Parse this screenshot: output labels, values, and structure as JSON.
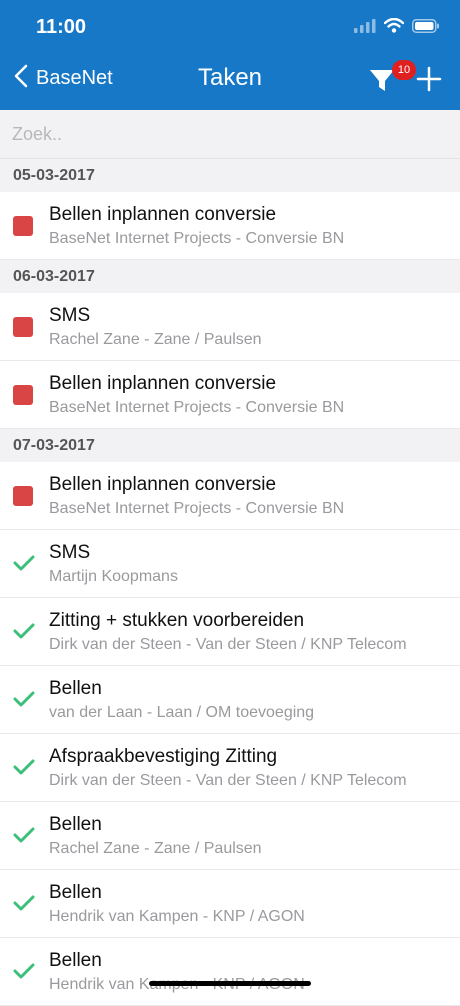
{
  "status_bar": {
    "time": "11:00"
  },
  "nav": {
    "back_label": "BaseNet",
    "title": "Taken",
    "filter_badge": "10"
  },
  "search": {
    "placeholder": "Zoek.."
  },
  "sections": [
    {
      "date": "05-03-2017",
      "items": [
        {
          "title": "Bellen inplannen conversie",
          "subtitle": "BaseNet Internet Projects - Conversie BN",
          "status": "open"
        }
      ]
    },
    {
      "date": "06-03-2017",
      "items": [
        {
          "title": "SMS",
          "subtitle": "Rachel Zane - Zane / Paulsen",
          "status": "open"
        },
        {
          "title": "Bellen inplannen conversie",
          "subtitle": "BaseNet Internet Projects - Conversie BN",
          "status": "open"
        }
      ]
    },
    {
      "date": "07-03-2017",
      "items": [
        {
          "title": "Bellen inplannen conversie",
          "subtitle": "BaseNet Internet Projects - Conversie BN",
          "status": "open"
        },
        {
          "title": "SMS",
          "subtitle": "Martijn Koopmans",
          "status": "done"
        },
        {
          "title": "Zitting + stukken voorbereiden",
          "subtitle": "Dirk van der Steen - Van der Steen / KNP Telecom",
          "status": "done"
        },
        {
          "title": "Bellen",
          "subtitle": "van der Laan - Laan / OM toevoeging",
          "status": "done"
        },
        {
          "title": "Afspraakbevestiging Zitting",
          "subtitle": "Dirk van der Steen - Van der Steen / KNP Telecom",
          "status": "done"
        },
        {
          "title": "Bellen",
          "subtitle": "Rachel Zane - Zane / Paulsen",
          "status": "done"
        },
        {
          "title": "Bellen",
          "subtitle": "Hendrik van Kampen - KNP / AGON",
          "status": "done"
        },
        {
          "title": "Bellen",
          "subtitle": "Hendrik van Kampen - KNP / AGON",
          "status": "done"
        }
      ]
    }
  ],
  "colors": {
    "nav_bg": "#1878c8",
    "open": "#d94444",
    "done": "#3bbf7a",
    "badge": "#e02020"
  },
  "icons": {
    "back": "chevron-left-icon",
    "filter": "filter-icon",
    "add": "plus-icon",
    "open": "red-square-icon",
    "done": "checkmark-icon"
  }
}
